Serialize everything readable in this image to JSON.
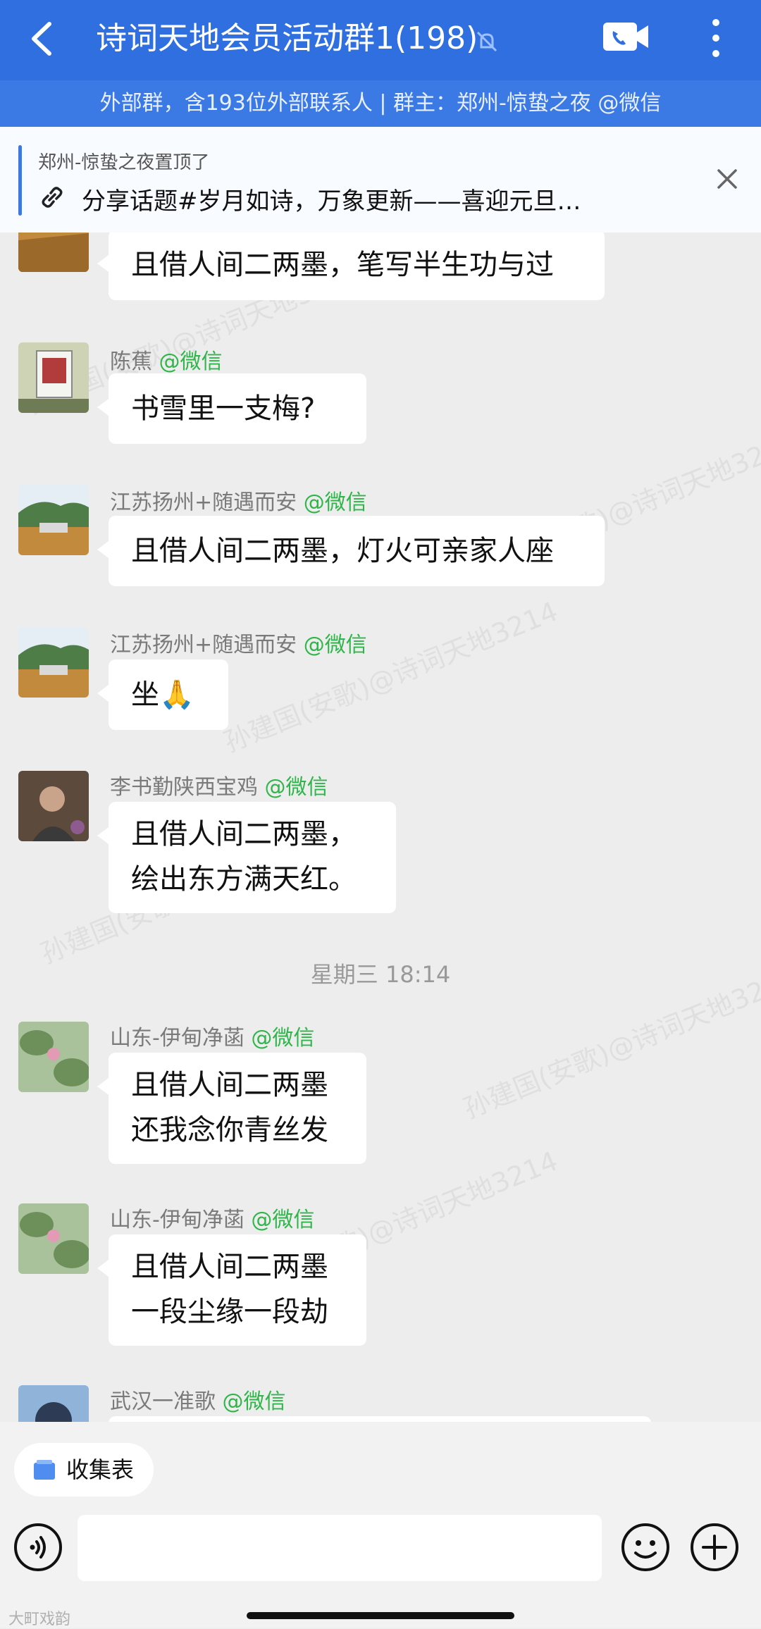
{
  "header": {
    "title": "诗词天地会员活动群1(198)",
    "subtitle": "外部群，含193位外部联系人 | 群主：郑州-惊蛰之夜 @微信"
  },
  "pinned": {
    "owner_note": "郑州-惊蛰之夜置顶了",
    "text": "分享话题#岁月如诗，万象更新——喜迎元旦…"
  },
  "messages": [
    {
      "name": "",
      "tag": "",
      "lines": [
        "且借人间二两墨，笔写半生功与过"
      ]
    },
    {
      "name": "陈蕉",
      "tag": "@微信",
      "lines": [
        "书雪里一支梅?"
      ]
    },
    {
      "name": "江苏扬州+随遇而安",
      "tag": "@微信",
      "lines": [
        "且借人间二两墨，灯火可亲家人座"
      ]
    },
    {
      "name": "江苏扬州+随遇而安",
      "tag": "@微信",
      "lines": [
        "坐🙏"
      ]
    },
    {
      "name": "李书勤陕西宝鸡",
      "tag": "@微信",
      "lines": [
        "且借人间二两墨，",
        "绘出东方满天红。"
      ]
    },
    {
      "name": "山东-伊甸净菡",
      "tag": "@微信",
      "lines": [
        "且借人间二两墨",
        "还我念你青丝发"
      ]
    },
    {
      "name": "山东-伊甸净菡",
      "tag": "@微信",
      "lines": [
        "且借人间二两墨",
        "一段尘缘一段劫"
      ]
    },
    {
      "name": "武汉一准歌",
      "tag": "@微信",
      "lines": []
    }
  ],
  "timestamp": "星期三 18:14",
  "watermark": "孙建国(安歌)@诗词天地3214",
  "bottom": {
    "collect_label": "收集表",
    "brand": "大町戏韵"
  },
  "colors": {
    "header": "#2f6fe0",
    "subheader": "#3b79e4",
    "tag_green": "#2fb54a",
    "background": "#ededed"
  },
  "icons": [
    "back-arrow-icon",
    "mute-icon",
    "video-call-icon",
    "more-icon",
    "link-icon",
    "close-icon",
    "collect-icon",
    "voice-icon",
    "emoji-icon",
    "plus-icon"
  ]
}
